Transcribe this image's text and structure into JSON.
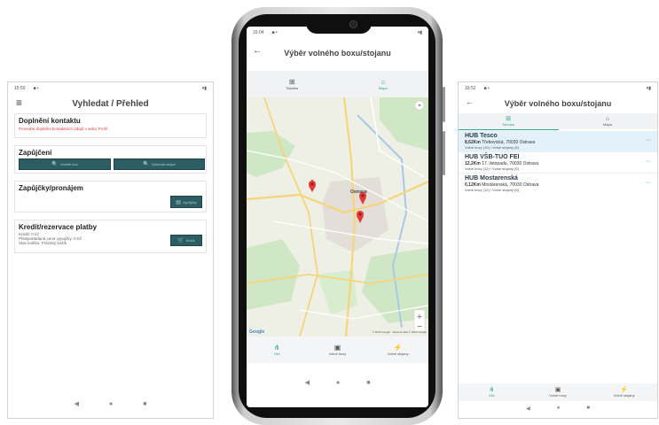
{
  "left_screen": {
    "status_time": "15:50",
    "title": "Vyhledat / Přehled",
    "contact": {
      "heading": "Doplnění kontaktu",
      "warning": "Proveďte doplnění kontaktních údajů v sekci Profil"
    },
    "loans": {
      "heading": "Zapůjčení",
      "button_1": "Umístit box",
      "button_2": "Vyhledat stojan"
    },
    "rentals": {
      "heading": "Zapůjčky/pronájem",
      "button": "Vypůjčky"
    },
    "credit": {
      "heading": "Kredit/rezervace platby",
      "line_1": "Kredit: 0 Kč",
      "line_2": "Předpokládaná cena vypujčky: 0 Kč",
      "line_3": "Stav košíku: Prázdný košík",
      "button": "Košík"
    }
  },
  "middle_screen": {
    "status_time": "16:04",
    "title": "Výběr volného boxu/stojanu",
    "tabs": [
      "Tabulka",
      "Mapa"
    ],
    "map": {
      "city_label": "Ostrava",
      "attribution": "Google",
      "copyright": "© 2022 Google · Mapová data © 2022 Google"
    },
    "bottom_nav": [
      "Vše",
      "Volné boxy",
      "Volné stojany"
    ]
  },
  "right_screen": {
    "status_time": "15:52",
    "title": "Výběr volného boxu/stojanu",
    "tabs": [
      "Tabulka",
      "Mapa"
    ],
    "hubs": [
      {
        "name": "HUB Tesco",
        "distance": "8,62",
        "unit": "Km",
        "address": "Třebovická, 70030 Ostrava",
        "boxes": "Volné boxy (10) / Volné stojany (6)"
      },
      {
        "name": "HUB VŠB-TUO FEI",
        "distance": "12,2",
        "unit": "Km",
        "address": "17. listopadu, 70030 Ostrava",
        "boxes": "Volné boxy (12) / Volné stojany (6)"
      },
      {
        "name": "HUB Mostarenská",
        "distance": "0,12",
        "unit": "Km",
        "address": "Mostárenská, 70030 Ostrava",
        "boxes": "Volné boxy (12) / Volné stojany (6)"
      }
    ],
    "bottom_nav": [
      "Vše",
      "Volné boxy",
      "Volné stojany"
    ]
  },
  "colors": {
    "accent": "#2aa89a",
    "button": "#2b5d63",
    "selected_row": "#e3f1fa",
    "warning_text": "#e53935"
  }
}
